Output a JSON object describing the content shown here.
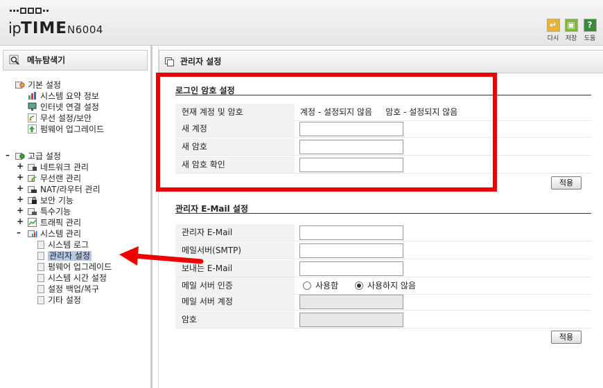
{
  "header": {
    "logo_main": "ipTIME",
    "logo_prefix": "ip",
    "logo_bold": "TIME",
    "logo_model": "N6004",
    "buttons": [
      {
        "label": "다시",
        "icon": "undo-icon",
        "color": "#e6b43a"
      },
      {
        "label": "저장",
        "icon": "save-icon",
        "color": "#7fb640"
      },
      {
        "label": "도움",
        "icon": "help-icon",
        "color": "#3a8a3a"
      }
    ]
  },
  "sidebar": {
    "title": "메뉴탐색기",
    "basic": {
      "label": "기본 설정",
      "items": [
        "시스템 요약 정보",
        "인터넷 연결 설정",
        "무선 설정/보안",
        "펌웨어 업그레이드"
      ]
    },
    "advanced": {
      "label": "고급 설정",
      "items": [
        "네트워크 관리",
        "무선랜 관리",
        "NAT/라우터 관리",
        "보안 기능",
        "특수기능",
        "트래픽 관리",
        "시스템 관리"
      ],
      "system_items": [
        "시스템 로그",
        "관리자 설정",
        "펌웨어 업그레이드",
        "시스템 시간 설정",
        "설정 백업/복구",
        "기타 설정"
      ],
      "selected": "관리자 설정"
    }
  },
  "main": {
    "title": "관리자 설정",
    "login_section": {
      "title": "로그인 암호 설정",
      "current_label": "현재 계정 및 암호",
      "current_account": "계정 - 설정되지 않음",
      "current_password": "암호 - 설정되지 않음",
      "new_account_label": "새 계정",
      "new_password_label": "새 암호",
      "confirm_password_label": "새 암호 확인",
      "apply_label": "적용"
    },
    "email_section": {
      "title": "관리자 E-Mail 설정",
      "admin_email_label": "관리자 E-Mail",
      "smtp_label": "메일서버(SMTP)",
      "sender_label": "보내는 E-Mail",
      "auth_label": "메일 서버 인증",
      "auth_options": [
        "사용함",
        "사용하지 않음"
      ],
      "auth_selected": "사용하지 않음",
      "server_account_label": "메일 서버 계정",
      "password_label": "암호",
      "apply_label": "적용"
    }
  },
  "annotation": {
    "highlight_color": "#ee0000"
  }
}
